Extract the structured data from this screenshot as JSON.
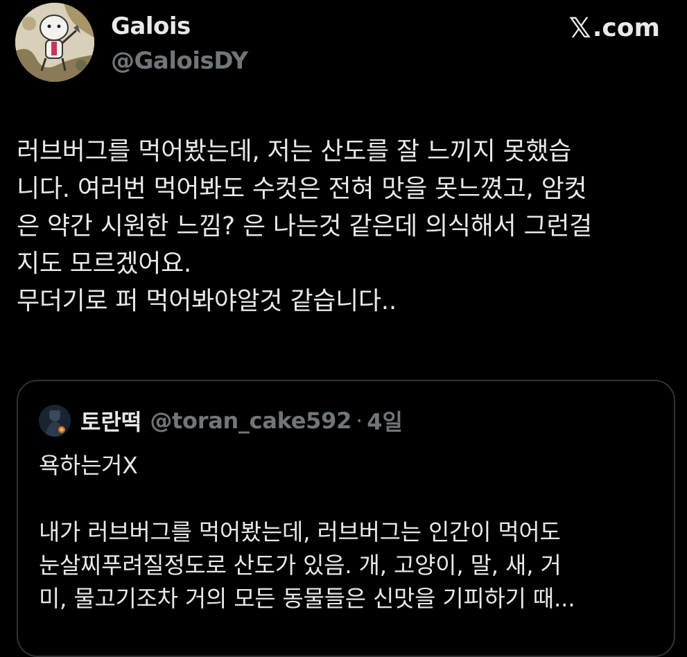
{
  "author": {
    "name": "Galois",
    "handle": "@GaloisDY"
  },
  "brand": {
    "mark": "𝕏",
    "label": ".com"
  },
  "tweet": {
    "text": "러브버그를 먹어봤는데, 저는 산도를 잘 느끼지 못했습\n니다. 여러번 먹어봐도 수컷은 전혀 맛을 못느꼈고, 암컷\n은 약간 시원한 느낌? 은 나는것 같은데 의식해서 그런걸\n지도 모르겠어요.\n무더기로 퍼 먹어봐야알것 같습니다.."
  },
  "quoted": {
    "name": "토란떡",
    "handle": "@toran_cake592",
    "separator": "·",
    "time": "4일",
    "text": "욕하는거X\n\n내가 러브버그를 먹어봤는데, 러브버그는 인간이 먹어도\n눈살찌푸려질정도로 산도가 있음. 개, 고양이, 말, 새, 거\n미, 물고기조차 거의 모든 동물들은 신맛을 기피하기 때..."
  },
  "colors": {
    "background": "#000000",
    "text": "#e7e9ea",
    "muted": "#71767b",
    "border": "#2f3336"
  },
  "icons": {
    "author_avatar": "avatar-illustration",
    "quoted_avatar": "avatar-dark-figure",
    "brand": "x-logo-icon"
  }
}
